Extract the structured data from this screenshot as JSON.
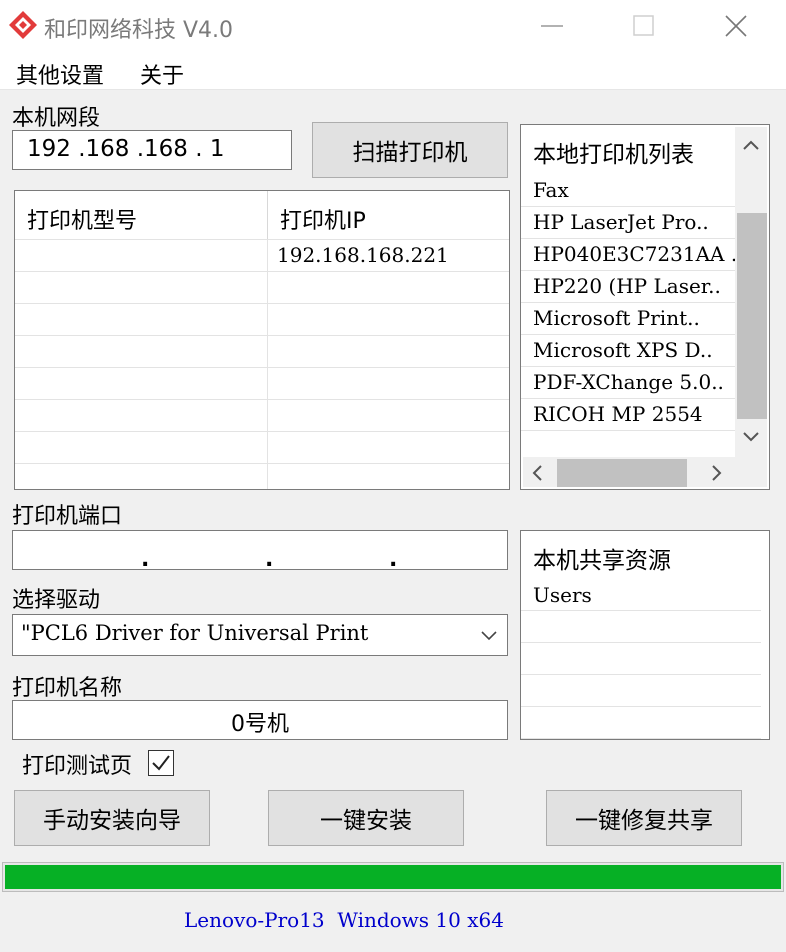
{
  "window": {
    "title": "和印网络科技 V4.0",
    "logo_icon": "red-diamond-logo-icon",
    "controls": [
      "minimize-icon",
      "maximize-icon",
      "close-icon"
    ]
  },
  "menu": [
    "其他设置",
    "关于"
  ],
  "subnet": {
    "label": "本机网段",
    "value": "192 .168 .168 . 1"
  },
  "scan_button": "扫描打印机",
  "printer_table": {
    "headers": [
      "打印机型号",
      "打印机IP"
    ],
    "rows": [
      {
        "model": "",
        "ip": "192.168.168.221"
      }
    ]
  },
  "local_printers": {
    "title": "本地打印机列表",
    "items": [
      "Fax",
      "HP LaserJet Pro..",
      "HP040E3C7231AA ..",
      "HP220 (HP Laser..",
      "Microsoft Print..",
      "Microsoft XPS D..",
      "PDF-XChange 5.0..",
      "RICOH MP 2554"
    ]
  },
  "port": {
    "label": "打印机端口",
    "separators": [
      ".",
      ".",
      "."
    ]
  },
  "driver": {
    "label": "选择驱动",
    "value": "\"PCL6 Driver for Universal Print"
  },
  "printer_name": {
    "label": "打印机名称",
    "value": "0号机"
  },
  "shared": {
    "title": "本机共享资源",
    "items": [
      "Users"
    ]
  },
  "test_page": {
    "label": "打印测试页",
    "checked": true
  },
  "buttons": {
    "manual": "手动安装向导",
    "install": "一键安装",
    "repair": "一键修复共享"
  },
  "progress": {
    "fraction": 1.0,
    "color": "#06b025"
  },
  "status_text": "Lenovo-Pro13  Windows 10 x64"
}
